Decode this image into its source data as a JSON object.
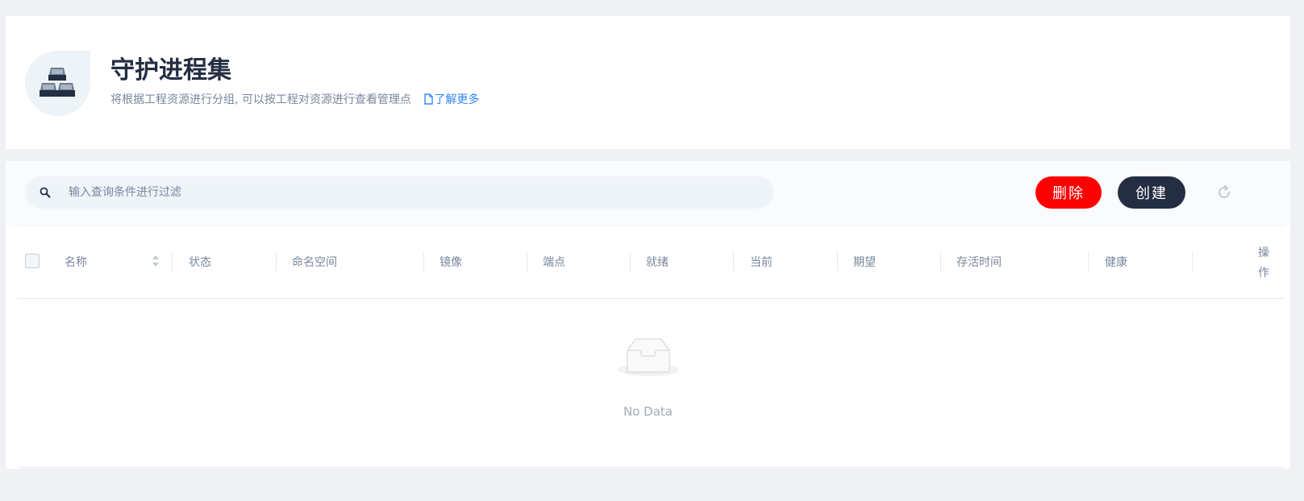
{
  "header": {
    "icon": "cluster-blocks-icon",
    "title": "守护进程集",
    "description": "将根据工程资源进行分组, 可以按工程对资源进行查看管理点",
    "learn_more_icon": "document-icon",
    "learn_more_label": "了解更多"
  },
  "toolbar": {
    "search_icon": "search-icon",
    "search_placeholder": "输入查询条件进行过滤",
    "search_value": "",
    "delete_label": "删除",
    "create_label": "创建",
    "refresh_icon": "refresh-icon"
  },
  "table": {
    "columns": [
      {
        "key": "name",
        "label": "名称",
        "sortable": true
      },
      {
        "key": "status",
        "label": "状态"
      },
      {
        "key": "namespace",
        "label": "命名空间"
      },
      {
        "key": "image",
        "label": "镜像"
      },
      {
        "key": "endpoints",
        "label": "端点"
      },
      {
        "key": "ready",
        "label": "就绪"
      },
      {
        "key": "current",
        "label": "当前"
      },
      {
        "key": "desired",
        "label": "期望"
      },
      {
        "key": "age",
        "label": "存活时间"
      },
      {
        "key": "health",
        "label": "健康"
      },
      {
        "key": "operations",
        "label": "操作"
      }
    ],
    "rows": [],
    "empty_icon": "inbox-icon",
    "empty_text": "No Data"
  },
  "colors": {
    "page_background": "#eff1f4",
    "delete_button": "#ff0000",
    "create_button": "#242e42",
    "link": "#3385ff",
    "muted_text": "#79879c"
  }
}
